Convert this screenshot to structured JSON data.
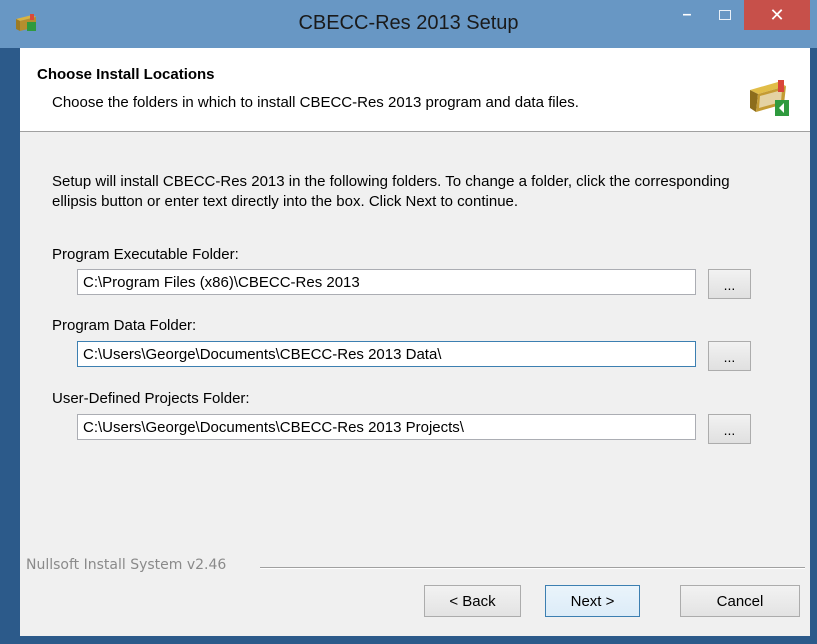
{
  "window": {
    "title": "CBECC-Res 2013 Setup",
    "minimize_glyph": "–",
    "close_glyph": "✕"
  },
  "header": {
    "title": "Choose Install Locations",
    "subtitle": "Choose the folders in which to install CBECC-Res 2013 program and data files."
  },
  "intro": "Setup will install CBECC-Res 2013 in the following folders. To change a folder, click the corresponding ellipsis button or enter text directly into the box. Click Next to continue.",
  "fields": [
    {
      "label": "Program Executable Folder:",
      "value": "C:\\Program Files (x86)\\CBECC-Res 2013",
      "browse": "..."
    },
    {
      "label": "Program Data Folder:",
      "value": "C:\\Users\\George\\Documents\\CBECC-Res 2013 Data\\",
      "browse": "..."
    },
    {
      "label": "User-Defined Projects Folder:",
      "value": "C:\\Users\\George\\Documents\\CBECC-Res 2013 Projects\\",
      "browse": "..."
    }
  ],
  "branding": "Nullsoft Install System v2.46",
  "buttons": {
    "back": "< Back",
    "next": "Next >",
    "cancel": "Cancel"
  },
  "colors": {
    "titlebar": "#6897c4",
    "frame": "#2c5a8a",
    "close": "#c7504a",
    "focus_border": "#3c7fb1"
  },
  "icons": {
    "app": "installer-app-icon",
    "header": "install-package-icon"
  }
}
